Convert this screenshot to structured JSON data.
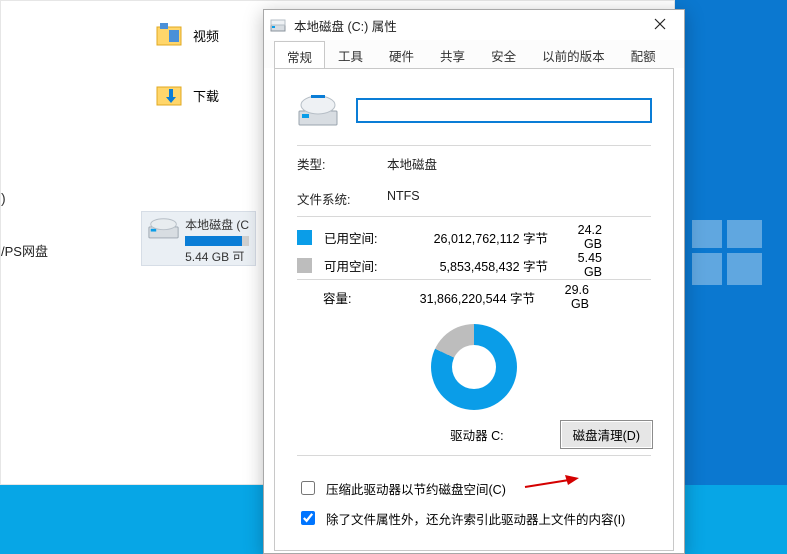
{
  "explorer": {
    "videos_label": "视频",
    "downloads_label": "下载",
    "wps_label": "/PS网盘",
    "paren": ")",
    "drive_tile": {
      "title": "本地磁盘 (C:",
      "free": "5.44 GB 可",
      "fill_pct": 82
    }
  },
  "dialog": {
    "title": "本地磁盘 (C:) 属性",
    "tabs": [
      "常规",
      "工具",
      "硬件",
      "共享",
      "安全",
      "以前的版本",
      "配额"
    ],
    "active_tab": 0,
    "name_value": "",
    "type_label": "类型:",
    "type_value": "本地磁盘",
    "fs_label": "文件系统:",
    "fs_value": "NTFS",
    "used_label": "已用空间:",
    "used_bytes": "26,012,762,112 字节",
    "used_gb": "24.2 GB",
    "free_label": "可用空间:",
    "free_bytes": "5,853,458,432 字节",
    "free_gb": "5.45 GB",
    "capacity_label": "容量:",
    "capacity_bytes": "31,866,220,544 字节",
    "capacity_gb": "29.6 GB",
    "drive_label": "驱动器 C:",
    "cleanup_button": "磁盘清理(D)",
    "compress_checked": false,
    "compress_label": "压缩此驱动器以节约磁盘空间(C)",
    "index_checked": true,
    "index_label": "除了文件属性外，还允许索引此驱动器上文件的内容(I)"
  },
  "chart_data": {
    "type": "pie",
    "title": "",
    "series": [
      {
        "name": "已用空间",
        "value": 24.2,
        "color": "#0a9de8"
      },
      {
        "name": "可用空间",
        "value": 5.45,
        "color": "#bdbdbd"
      }
    ],
    "unit": "GB",
    "total": 29.6
  }
}
